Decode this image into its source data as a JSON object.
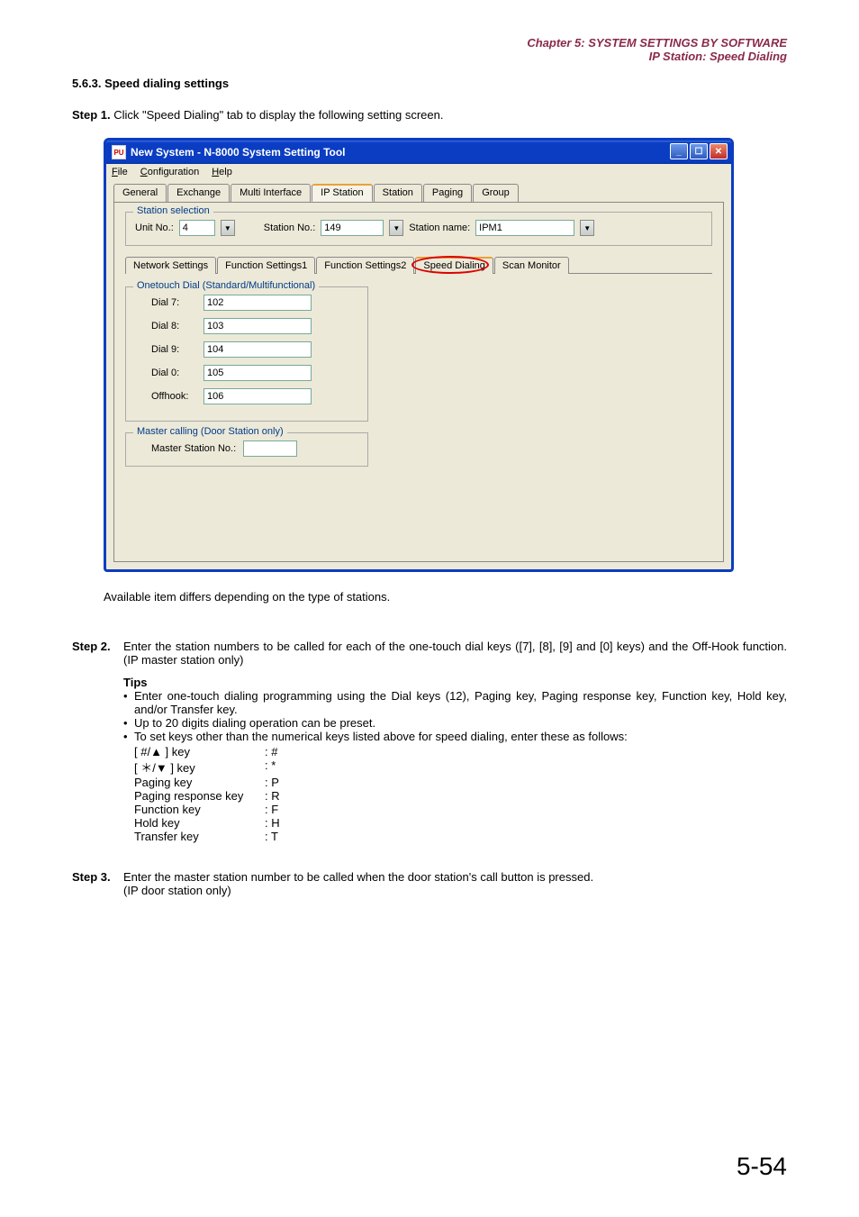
{
  "header": {
    "line1": "Chapter 5:  SYSTEM SETTINGS BY SOFTWARE",
    "line2": "IP Station: Speed Dialing"
  },
  "section_heading": "5.6.3. Speed dialing settings",
  "step1": {
    "label": "Step 1.",
    "text": "Click \"Speed Dialing\" tab to display the following setting screen."
  },
  "window": {
    "icon_text": "PU",
    "title": "New System - N-8000 System Setting Tool",
    "minimize": "_",
    "maximize": "☐",
    "close": "✕",
    "menu": {
      "file": "File",
      "config": "Configuration",
      "help": "Help"
    },
    "tabs": {
      "general": "General",
      "exchange": "Exchange",
      "multiinterface": "Multi Interface",
      "ipstation": "IP Station",
      "station": "Station",
      "paging": "Paging",
      "group": "Group"
    },
    "station_selection": {
      "legend": "Station selection",
      "unit_label": "Unit No.:",
      "unit_value": "4",
      "stn_no_label": "Station No.:",
      "stn_no_value": "149",
      "stn_name_label": "Station name:",
      "stn_name_value": "IPM1"
    },
    "subtabs": {
      "network": "Network Settings",
      "fs1": "Function Settings1",
      "fs2": "Function Settings2",
      "speed": "Speed Dialing",
      "scan": "Scan Monitor"
    },
    "onetouch": {
      "legend": "Onetouch Dial (Standard/Multifunctional)",
      "rows": [
        {
          "label": "Dial 7:",
          "value": "102"
        },
        {
          "label": "Dial 8:",
          "value": "103"
        },
        {
          "label": "Dial 9:",
          "value": "104"
        },
        {
          "label": "Dial 0:",
          "value": "105"
        },
        {
          "label": "Offhook:",
          "value": "106"
        }
      ]
    },
    "master_calling": {
      "legend": "Master calling (Door Station only)",
      "label": "Master Station No.:",
      "value": ""
    }
  },
  "available_note": "Available item differs depending on the type of stations.",
  "step2": {
    "label": "Step 2.",
    "line1": "Enter the station numbers to be called for each of the one-touch dial keys ([7], [8], [9] and [0] keys) and the Off-Hook function. (IP master station only)",
    "tips_heading": "Tips",
    "tip1": "Enter one-touch dialing programming using the Dial keys (12), Paging key, Paging response key, Function key, Hold key, and/or Transfer key.",
    "tip2": "Up to 20 digits dialing operation can be preset.",
    "tip3": "To set keys other than the numerical keys listed above for speed dialing, enter these as follows:",
    "keys": [
      {
        "name": "[ #/▲ ] key",
        "val": ": #"
      },
      {
        "name": "[ ＊/▼ ] key",
        "val": ": *"
      },
      {
        "name": "Paging key",
        "val": ": P"
      },
      {
        "name": "Paging response key",
        "val": ": R"
      },
      {
        "name": "Function key",
        "val": ": F"
      },
      {
        "name": "Hold key",
        "val": ": H"
      },
      {
        "name": "Transfer key",
        "val": ": T"
      }
    ]
  },
  "step3": {
    "label": "Step 3.",
    "line1": "Enter the master station number to be called when the door station's call button is pressed.",
    "line2": "(IP door station only)"
  },
  "page_number": "5-54"
}
